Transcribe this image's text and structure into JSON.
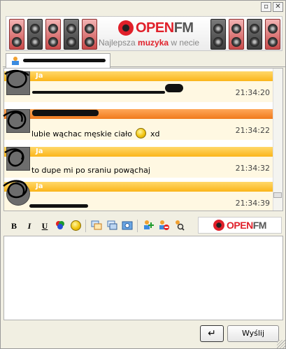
{
  "window": {
    "restore_glyph": "▫",
    "close_glyph": "✕"
  },
  "banner": {
    "logo_left": "OPEN",
    "logo_right": "FM",
    "tagline_pre": "Najlepsza ",
    "tagline_accent": "muzyka",
    "tagline_post": " w necie"
  },
  "tab": {
    "icon": "contact-icon"
  },
  "messages": [
    {
      "sender": "Ja",
      "text": "",
      "time": "21:34:20",
      "bar": "yellow"
    },
    {
      "sender": "",
      "text": "lubie wąchac męskie ciało",
      "suffix": "xd",
      "time": "21:34:22",
      "bar": "orange",
      "emoticon": "smile-icon"
    },
    {
      "sender": "Ja",
      "text": "to dupe mi po sraniu powąchaj",
      "time": "21:34:32",
      "bar": "yellow"
    },
    {
      "sender": "Ja",
      "text": "",
      "time": "21:34:39",
      "bar": "yellow"
    }
  ],
  "toolbar": {
    "bold": "B",
    "italic": "I",
    "underline": "U",
    "logo_left": "OPEN",
    "logo_right": "FM"
  },
  "buttons": {
    "enter_glyph": "↵",
    "send": "Wyślij"
  },
  "colors": {
    "accent": "#e0202a",
    "bar_yellow": "#fbb51a",
    "bar_orange": "#f07a1c",
    "msg_bg": "#fff8e2"
  }
}
